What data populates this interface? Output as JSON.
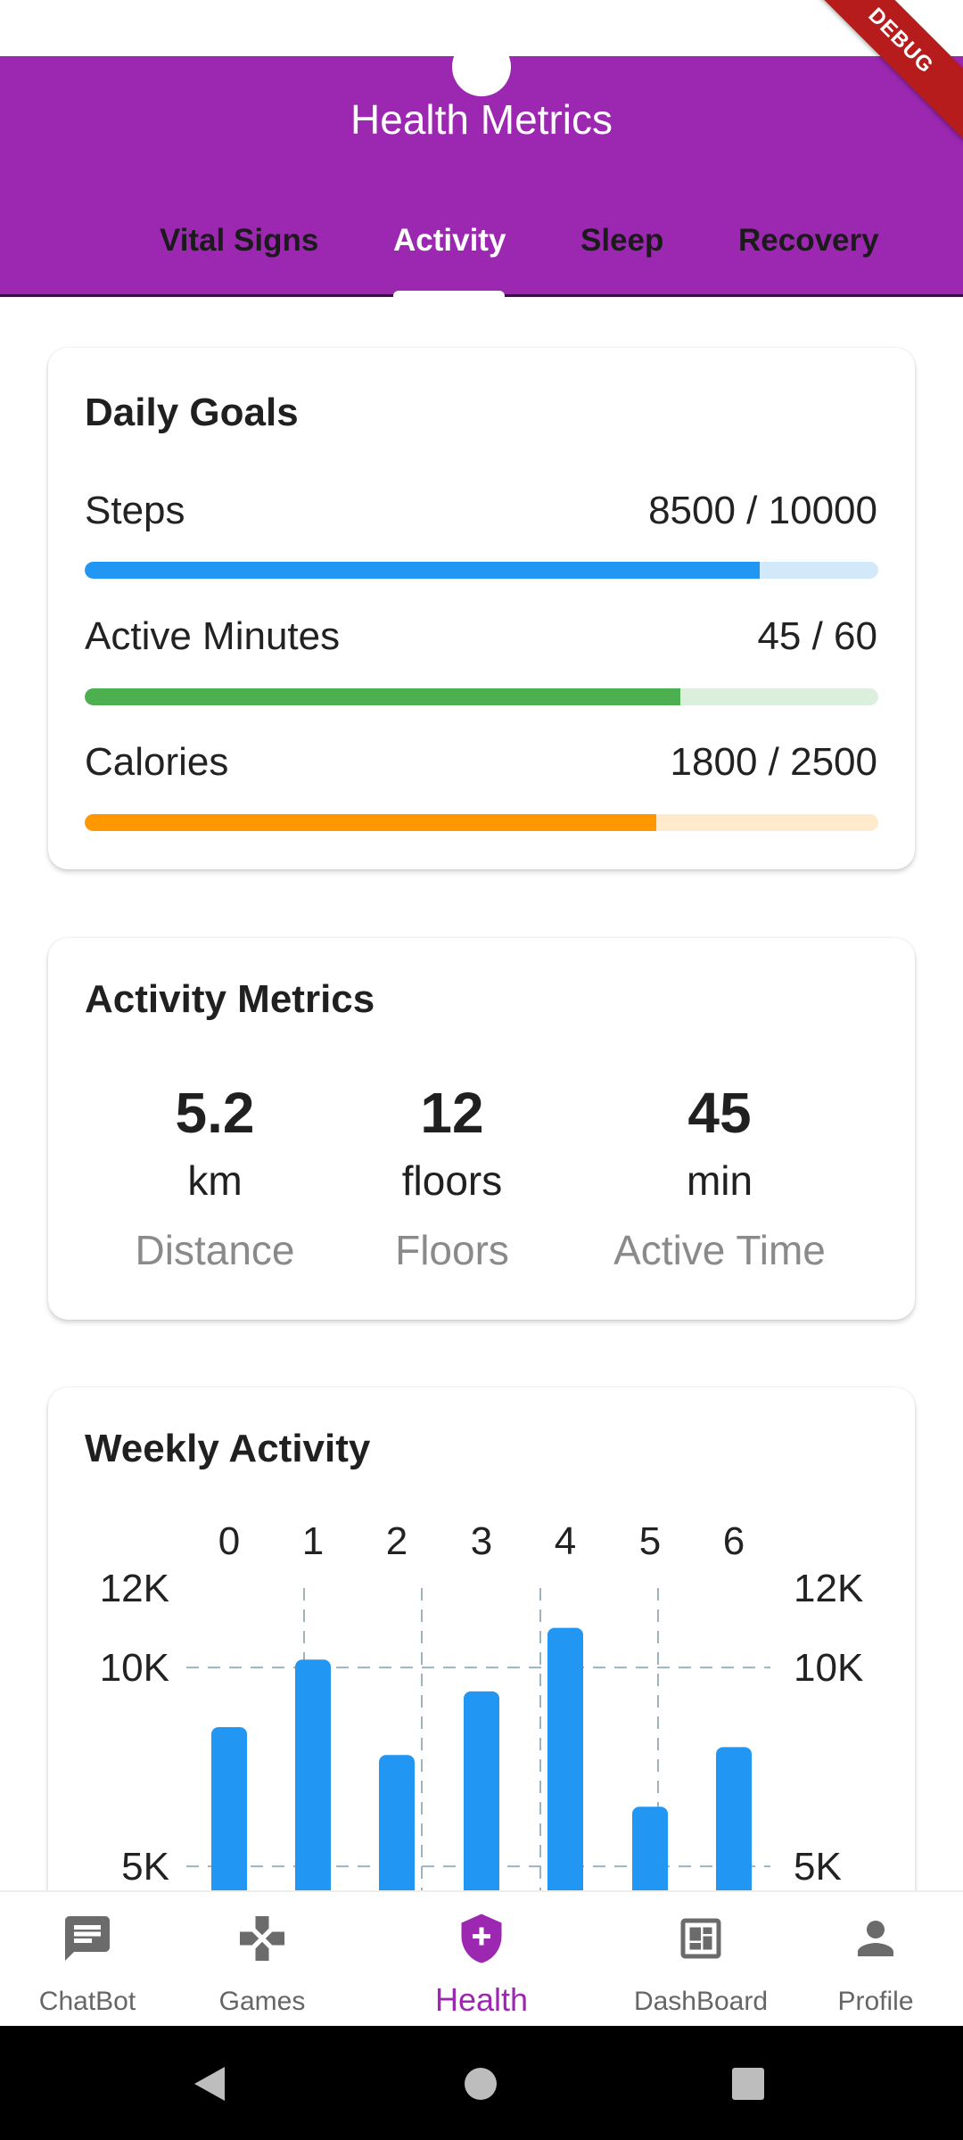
{
  "app": {
    "title": "Health Metrics",
    "debug_label": "DEBUG"
  },
  "tabs": [
    {
      "label": "Vital Signs",
      "active": false
    },
    {
      "label": "Activity",
      "active": true
    },
    {
      "label": "Sleep",
      "active": false
    },
    {
      "label": "Recovery",
      "active": false
    }
  ],
  "daily_goals": {
    "title": "Daily Goals",
    "items": [
      {
        "label": "Steps",
        "value_text": "8500 / 10000",
        "current": 8500,
        "target": 10000,
        "color": "#2196f3",
        "track_color": "#d2e9fb"
      },
      {
        "label": "Active Minutes",
        "value_text": "45 / 60",
        "current": 45,
        "target": 60,
        "color": "#4caf50",
        "track_color": "#dbefdc"
      },
      {
        "label": "Calories",
        "value_text": "1800 / 2500",
        "current": 1800,
        "target": 2500,
        "color": "#ff9800",
        "track_color": "#ffeacc"
      }
    ]
  },
  "activity_metrics": {
    "title": "Activity Metrics",
    "items": [
      {
        "value": "5.2",
        "unit": "km",
        "label": "Distance"
      },
      {
        "value": "12",
        "unit": "floors",
        "label": "Floors"
      },
      {
        "value": "45",
        "unit": "min",
        "label": "Active Time"
      }
    ]
  },
  "weekly_activity": {
    "title": "Weekly Activity"
  },
  "chart_data": {
    "type": "bar",
    "title": "Weekly Activity",
    "categories": [
      "0",
      "1",
      "2",
      "3",
      "4",
      "5",
      "6"
    ],
    "values": [
      8500,
      10200,
      7800,
      9400,
      11000,
      6500,
      8000
    ],
    "y_ticks": [
      "5K",
      "10K",
      "12K"
    ],
    "y_tick_values": [
      5000,
      10000,
      12000
    ],
    "ylim": [
      0,
      12000
    ],
    "bar_color": "#2196f3",
    "grid": true
  },
  "bottom_nav": [
    {
      "label": "ChatBot",
      "icon": "chat-icon",
      "active": false
    },
    {
      "label": "Games",
      "icon": "gamepad-icon",
      "active": false
    },
    {
      "label": "Health",
      "icon": "health-shield-icon",
      "active": true
    },
    {
      "label": "DashBoard",
      "icon": "dashboard-icon",
      "active": false
    },
    {
      "label": "Profile",
      "icon": "person-icon",
      "active": false
    }
  ]
}
